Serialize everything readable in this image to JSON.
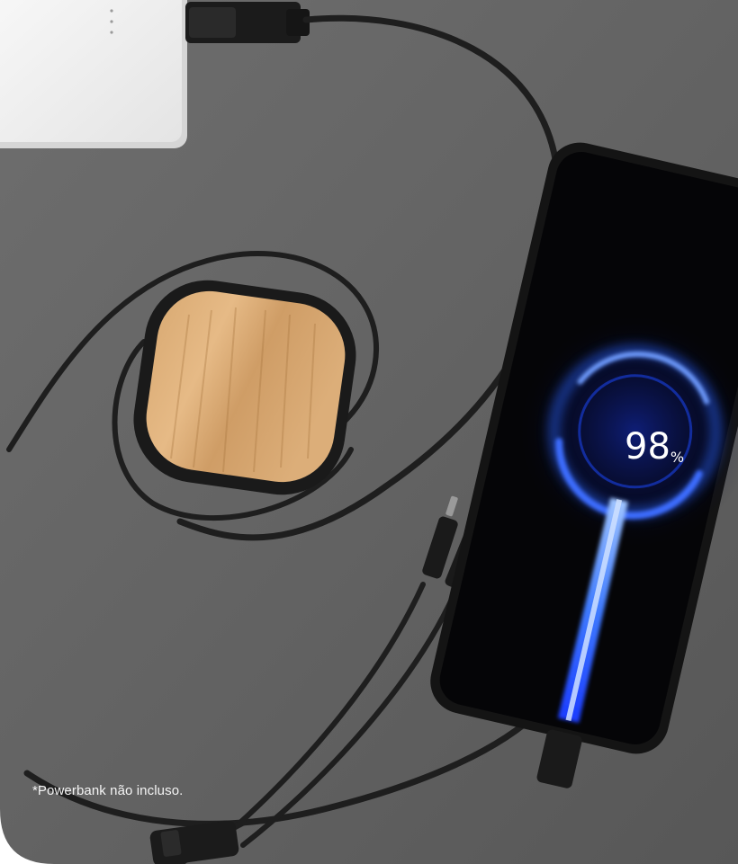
{
  "phone_screen": {
    "battery_value": "98",
    "battery_unit": "%"
  },
  "footnote": "*Powerbank não incluso."
}
